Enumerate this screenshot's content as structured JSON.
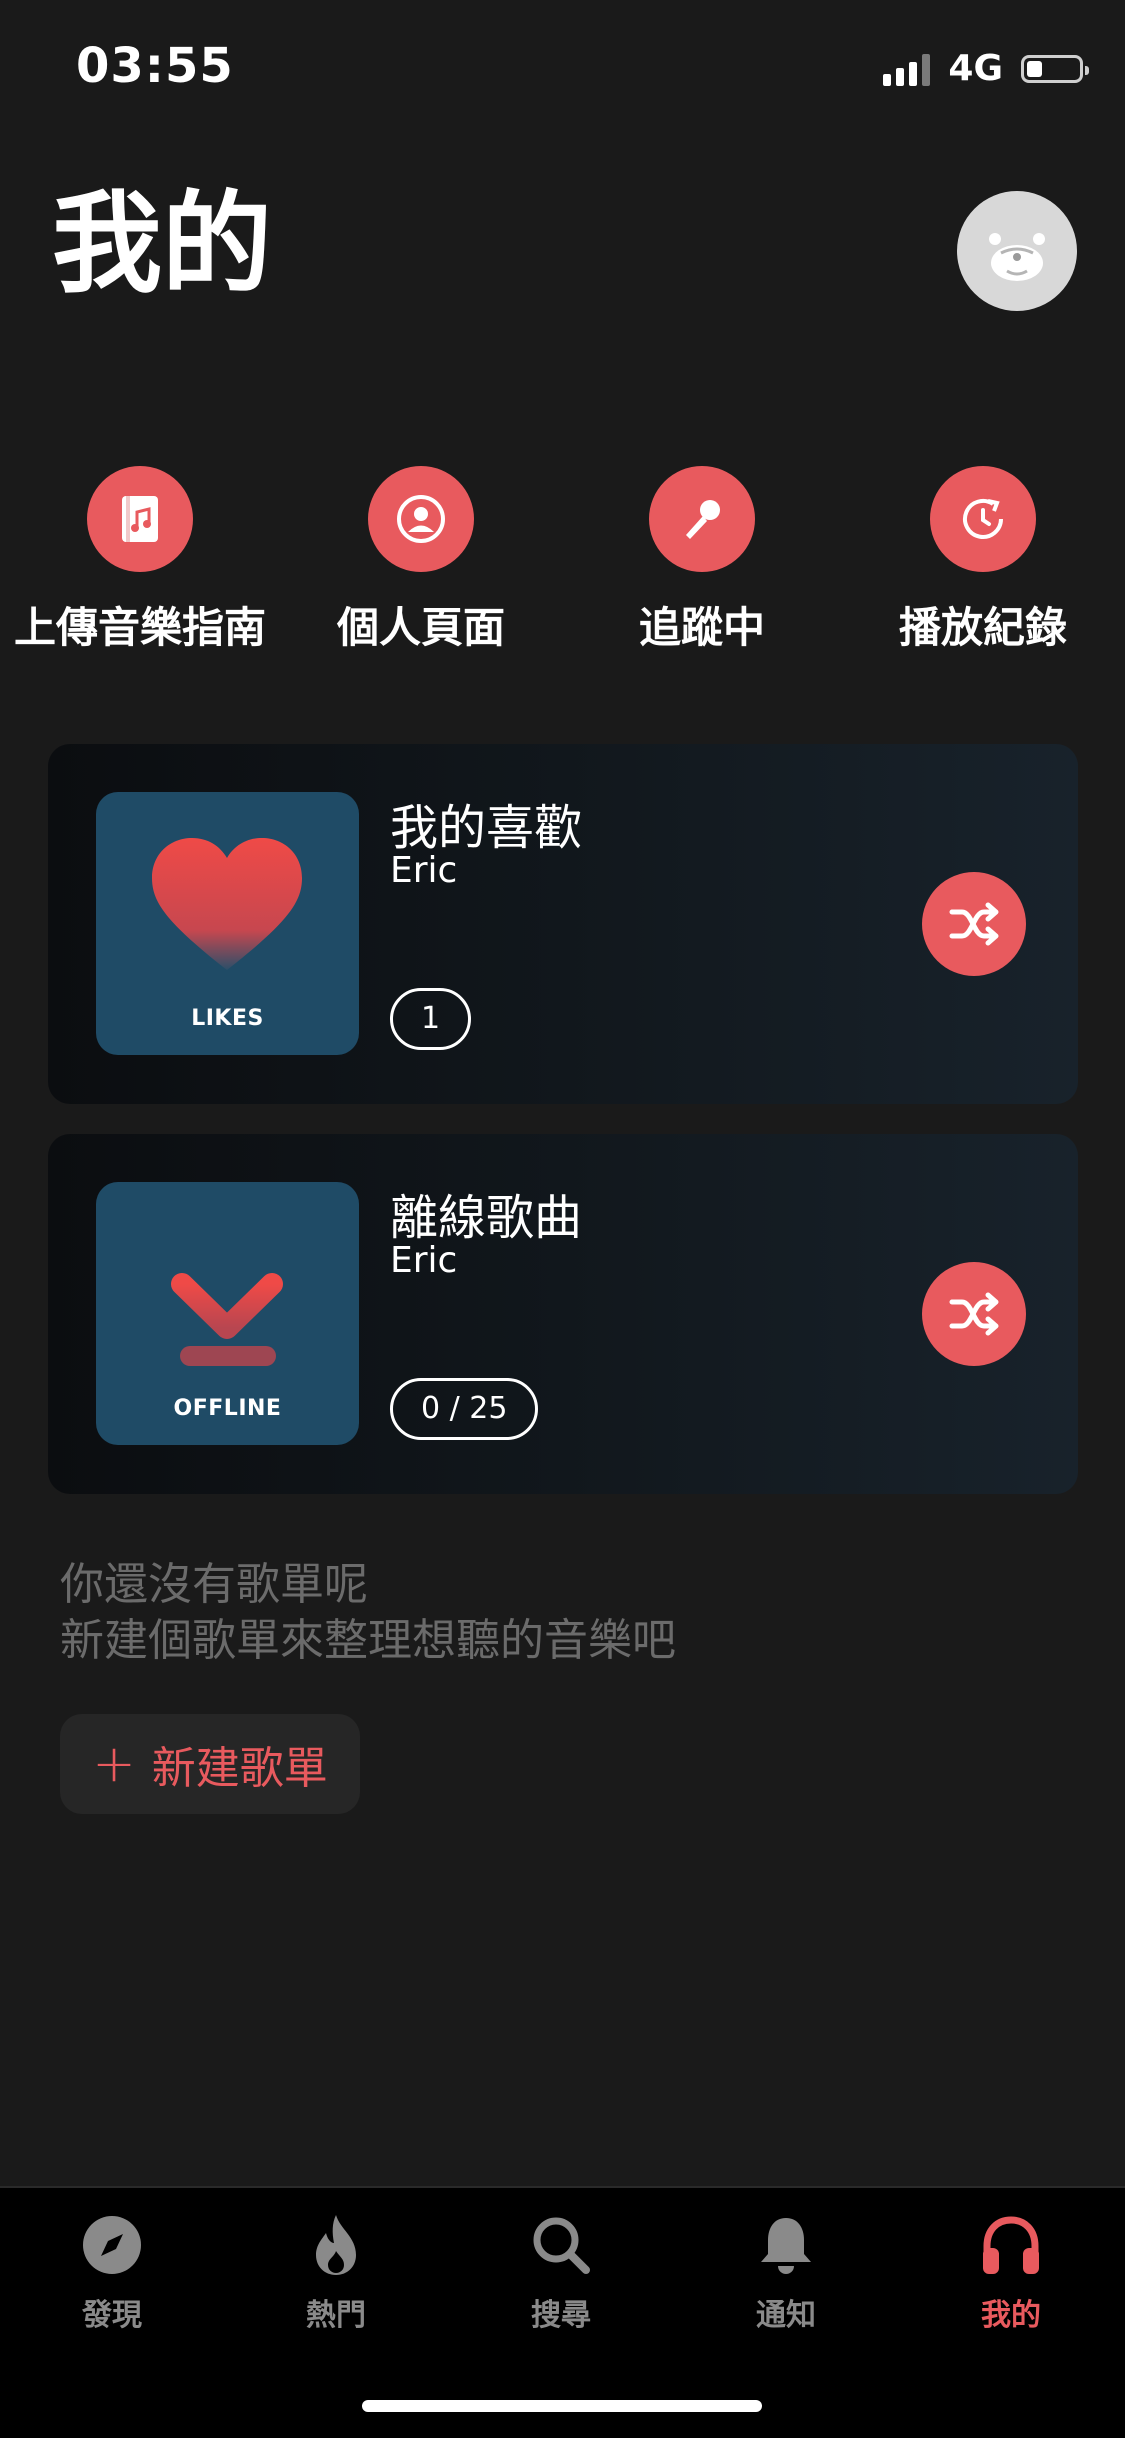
{
  "status_bar": {
    "time": "03:55",
    "network": "4G",
    "battery_level": 0.3
  },
  "header": {
    "title": "我的"
  },
  "quick_actions": [
    {
      "label": "上傳音樂指南",
      "icon": "music-book-icon"
    },
    {
      "label": "個人頁面",
      "icon": "person-icon"
    },
    {
      "label": "追蹤中",
      "icon": "microphone-icon"
    },
    {
      "label": "播放紀錄",
      "icon": "history-icon"
    }
  ],
  "playlists": [
    {
      "title": "我的喜歡",
      "owner": "Eric",
      "count": "1",
      "cover_label": "LIKES",
      "cover_icon": "heart-icon"
    },
    {
      "title": "離線歌曲",
      "owner": "Eric",
      "count": "0 / 25",
      "cover_label": "OFFLINE",
      "cover_icon": "download-icon"
    }
  ],
  "empty_state": {
    "line1": "你還沒有歌單呢",
    "line2": "新建個歌單來整理想聽的音樂吧"
  },
  "new_playlist": {
    "plus": "+",
    "label": "新建歌單"
  },
  "tabs": [
    {
      "label": "發現",
      "icon": "compass-icon",
      "active": false
    },
    {
      "label": "熱門",
      "icon": "flame-icon",
      "active": false
    },
    {
      "label": "搜尋",
      "icon": "search-icon",
      "active": false
    },
    {
      "label": "通知",
      "icon": "bell-icon",
      "active": false
    },
    {
      "label": "我的",
      "icon": "headphones-icon",
      "active": true
    }
  ],
  "colors": {
    "accent": "#e85a5e",
    "background": "#1a1a1a",
    "tab_bar": "#000000",
    "muted_text": "#6b6b6b",
    "inactive_tab": "#8a8a8a"
  }
}
